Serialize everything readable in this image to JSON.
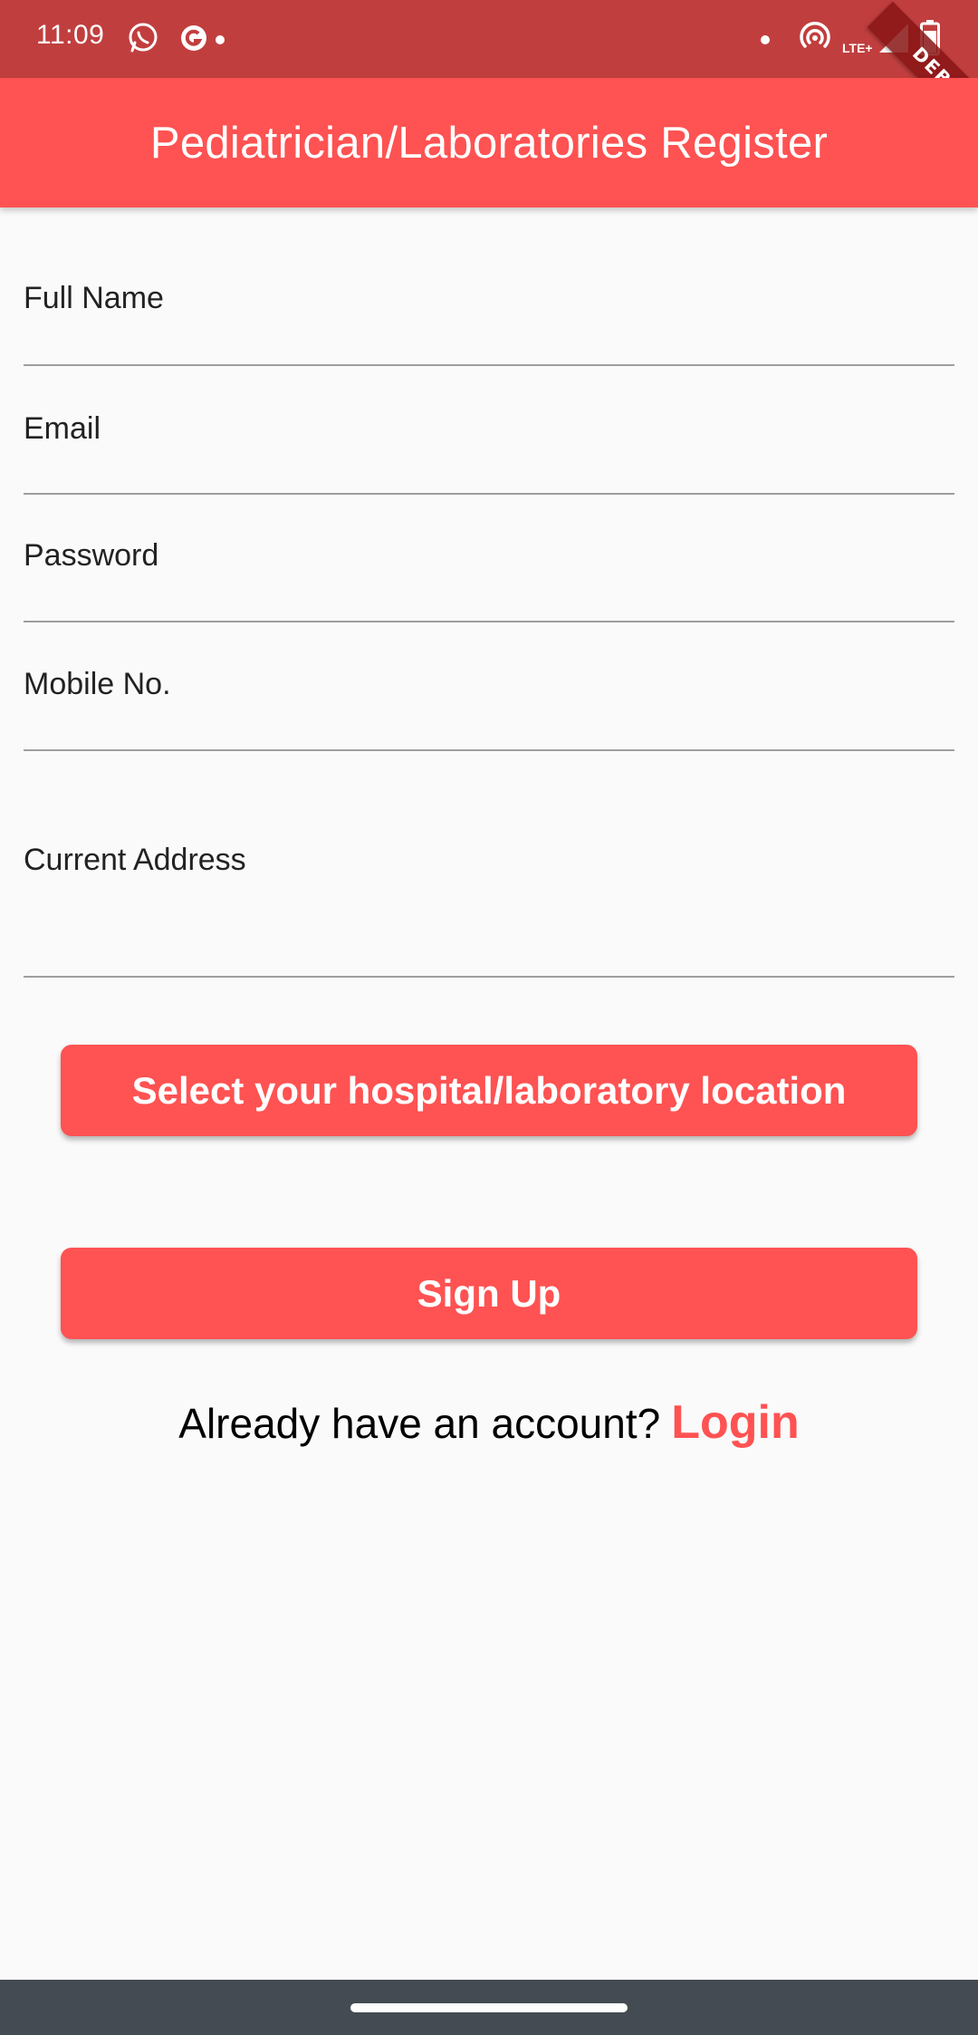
{
  "status_bar": {
    "time": "11:09",
    "icons": [
      "whatsapp-icon",
      "g-app-icon",
      "hotspot-icon",
      "signal-icon",
      "battery-icon"
    ],
    "network": "LTE+",
    "debug_label": "DEBUG"
  },
  "app_bar": {
    "title": "Pediatrician/Laboratories Register"
  },
  "form": {
    "full_name_label": "Full Name",
    "email_label": "Email",
    "password_label": "Password",
    "mobile_label": "Mobile No.",
    "address_label": "Current Address"
  },
  "buttons": {
    "select_location": "Select your hospital/laboratory location",
    "sign_up": "Sign Up"
  },
  "footer": {
    "prompt": "Already have an account?",
    "login": "Login"
  },
  "colors": {
    "primary": "#ff5252",
    "status_bar": "#c13e3e",
    "background": "#fafafa",
    "nav_bar": "#454b52"
  }
}
